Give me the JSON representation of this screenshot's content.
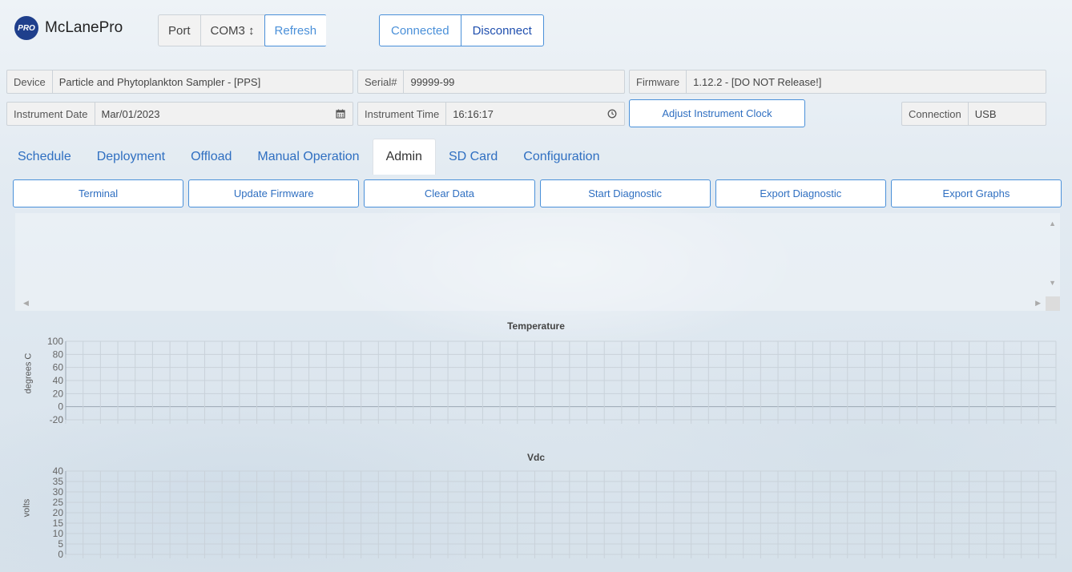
{
  "brand": {
    "logo_text": "PRO",
    "name": "McLanePro"
  },
  "port": {
    "label": "Port",
    "value": "COM3 ↕",
    "refresh_label": "Refresh"
  },
  "connection_toggle": {
    "connected_label": "Connected",
    "disconnect_label": "Disconnect"
  },
  "device": {
    "label": "Device",
    "value": "Particle and Phytoplankton Sampler - [PPS]"
  },
  "serial": {
    "label": "Serial#",
    "value": "99999-99"
  },
  "firmware": {
    "label": "Firmware",
    "value": "1.12.2 - [DO NOT Release!]"
  },
  "instrument_date": {
    "label": "Instrument Date",
    "value": "Mar/01/2023"
  },
  "instrument_time": {
    "label": "Instrument Time",
    "value": "16:16:17"
  },
  "adjust_clock_label": "Adjust Instrument Clock",
  "connection_type": {
    "label": "Connection",
    "value": "USB"
  },
  "tabs": [
    {
      "label": "Schedule"
    },
    {
      "label": "Deployment"
    },
    {
      "label": "Offload"
    },
    {
      "label": "Manual Operation"
    },
    {
      "label": "Admin",
      "active": true
    },
    {
      "label": "SD Card"
    },
    {
      "label": "Configuration"
    }
  ],
  "actions": [
    {
      "label": "Terminal"
    },
    {
      "label": "Update Firmware"
    },
    {
      "label": "Clear Data"
    },
    {
      "label": "Start Diagnostic"
    },
    {
      "label": "Export Diagnostic"
    },
    {
      "label": "Export Graphs"
    }
  ],
  "colors": {
    "accent": "#4a90d9",
    "brand": "#1f3f8c",
    "grid": "#c9d2da"
  },
  "chart_data": [
    {
      "type": "line",
      "title": "Temperature",
      "ylabel": "degrees C",
      "xlabel": "",
      "yticks": [
        100,
        80,
        60,
        40,
        20,
        0,
        -20
      ],
      "ylim": [
        -20,
        100
      ],
      "series": [],
      "grid": true
    },
    {
      "type": "line",
      "title": "Vdc",
      "ylabel": "volts",
      "xlabel": "",
      "yticks": [
        40,
        35,
        30,
        25,
        20,
        15,
        10,
        5,
        0
      ],
      "ylim": [
        0,
        40
      ],
      "series": [],
      "grid": true
    }
  ]
}
